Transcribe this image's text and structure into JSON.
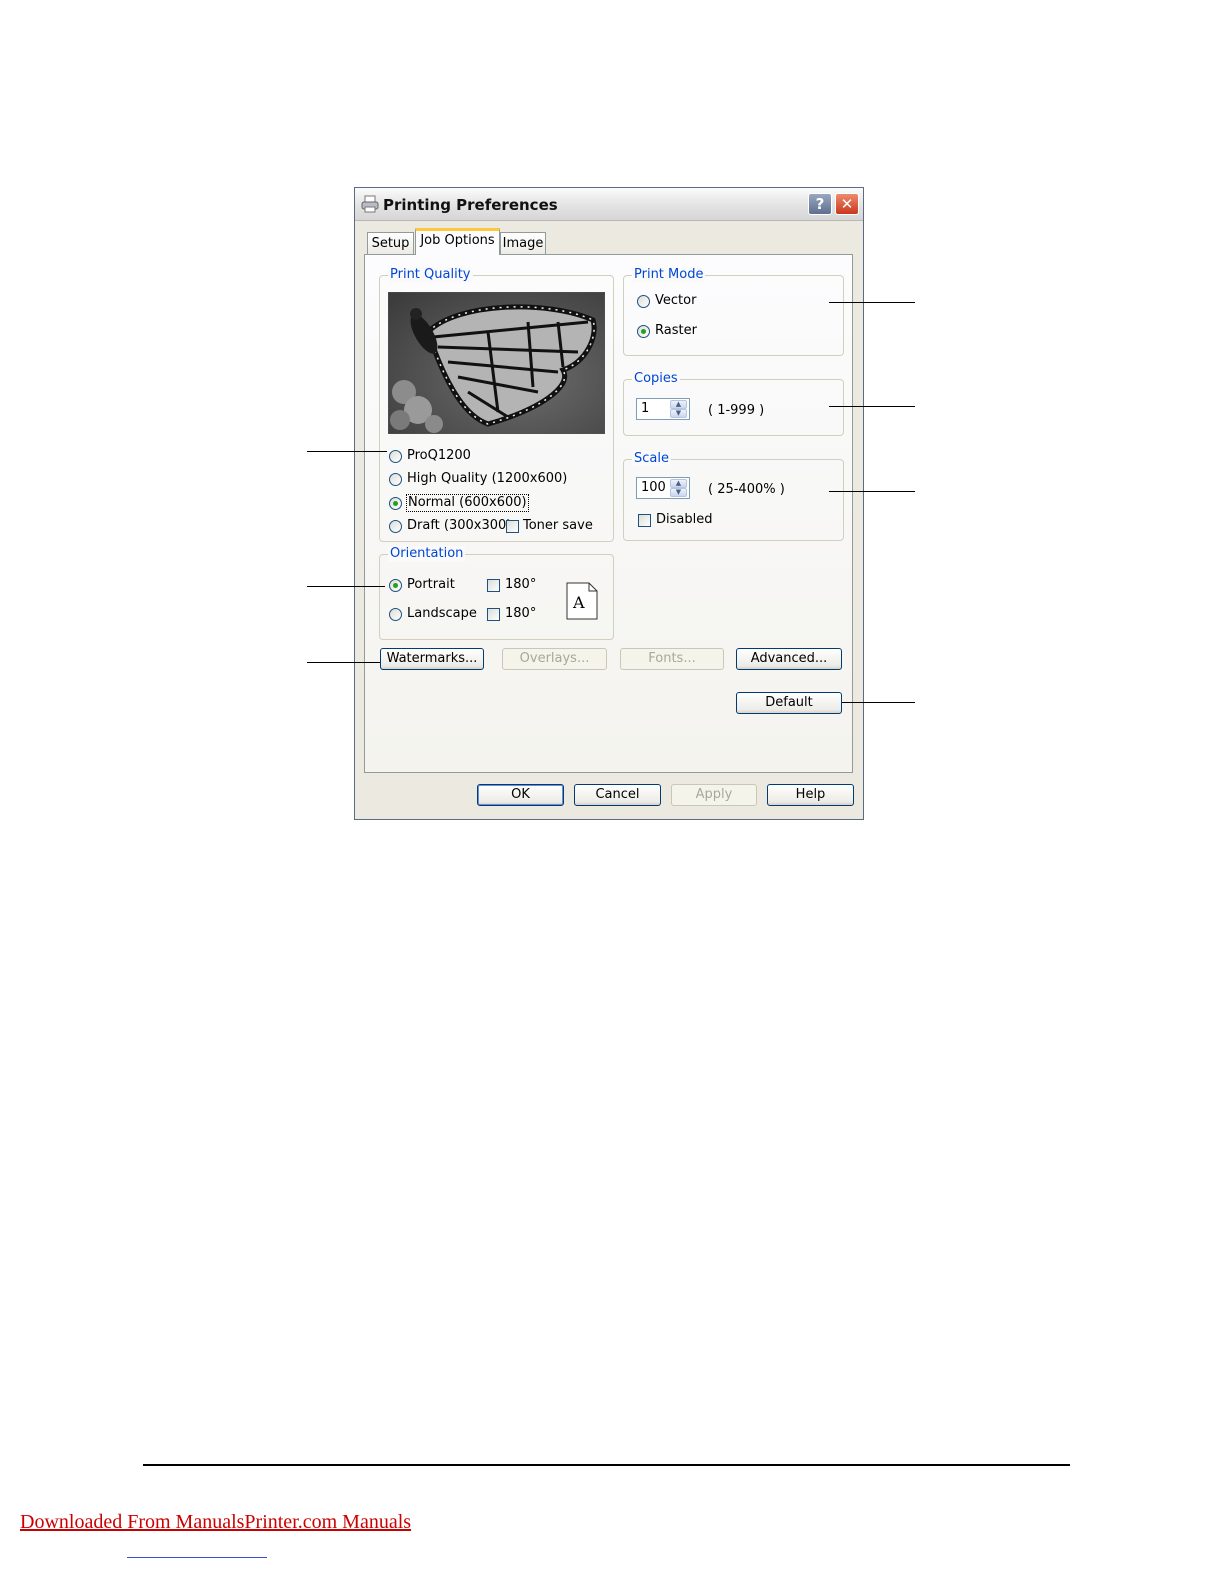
{
  "dialog": {
    "title": "Printing Preferences",
    "help_glyph": "?",
    "close_glyph": "✕",
    "tabs": [
      {
        "label": "Setup",
        "active": false
      },
      {
        "label": "Job Options",
        "active": true
      },
      {
        "label": "Image",
        "active": false
      }
    ]
  },
  "print_quality": {
    "legend": "Print Quality",
    "preview_image": "butterfly-preview",
    "options": [
      {
        "label": "ProQ1200",
        "selected": false
      },
      {
        "label": "High Quality (1200x600)",
        "selected": false
      },
      {
        "label": "Normal (600x600)",
        "selected": true
      },
      {
        "label": "Draft (300x300)",
        "selected": false
      }
    ],
    "toner_save": {
      "label": "Toner save",
      "checked": false
    }
  },
  "orientation": {
    "legend": "Orientation",
    "options": [
      {
        "label": "Portrait",
        "selected": true,
        "rotate_label": "180°",
        "rotate_checked": false
      },
      {
        "label": "Landscape",
        "selected": false,
        "rotate_label": "180°",
        "rotate_checked": false
      }
    ],
    "page_glyph": "A"
  },
  "print_mode": {
    "legend": "Print Mode",
    "options": [
      {
        "label": "Vector",
        "selected": false
      },
      {
        "label": "Raster",
        "selected": true
      }
    ]
  },
  "copies": {
    "legend": "Copies",
    "value": "1",
    "range": "( 1-999 )"
  },
  "scale": {
    "legend": "Scale",
    "value": "100",
    "range": "( 25-400% )",
    "disabled": {
      "label": "Disabled",
      "checked": false
    }
  },
  "buttons": {
    "watermarks": "Watermarks...",
    "overlays": "Overlays...",
    "fonts": "Fonts...",
    "advanced": "Advanced...",
    "default": "Default",
    "ok": "OK",
    "cancel": "Cancel",
    "apply": "Apply",
    "help": "Help"
  },
  "footer": {
    "link_text": "Downloaded From ManualsPrinter.com Manuals"
  },
  "colors": {
    "accent": "#0046d5",
    "selected_radio": "#21a121",
    "footer_link": "#cc0000"
  }
}
